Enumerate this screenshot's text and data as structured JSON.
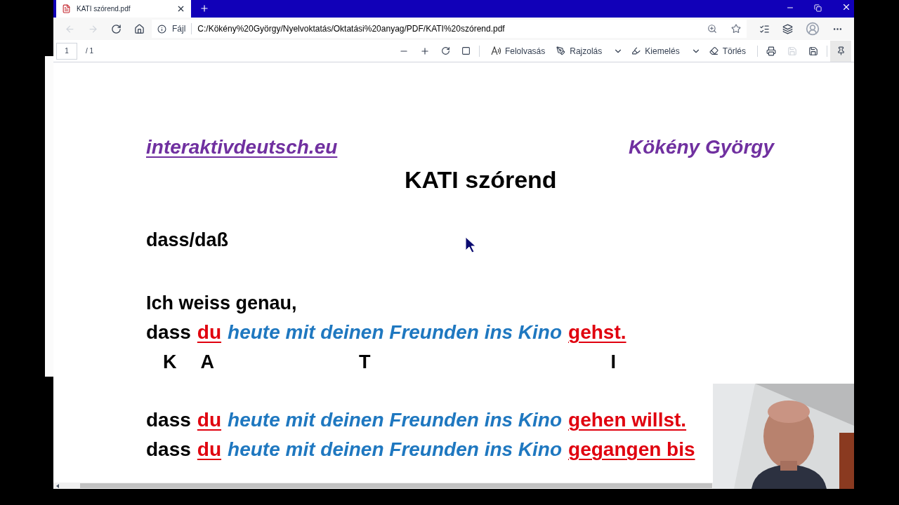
{
  "tab": {
    "title": "KATI szórend.pdf",
    "selected": true
  },
  "address_bar": {
    "scheme_label": "Fájl",
    "url": "C:/Kökény%20György/Nyelvoktatás/Oktatási%20anyag/PDF/KATI%20szórend.pdf"
  },
  "pdf_toolbar": {
    "page": "1",
    "page_count": "/ 1",
    "tools": [
      {
        "kind": "read",
        "label": "Felolvasás"
      },
      {
        "kind": "draw",
        "label": "Rajzolás"
      },
      {
        "kind": "highlight",
        "label": "Kiemelés"
      },
      {
        "kind": "erase",
        "label": "Törlés"
      }
    ]
  },
  "document": {
    "link": "interaktivdeutsch.eu",
    "author": "Kökény György",
    "title": "KATI szórend",
    "heading": "dass/daß",
    "intro": "Ich weiss genau,",
    "sentences": [
      {
        "parts": [
          {
            "kind": "plain",
            "text": "dass"
          },
          {
            "kind": "subject",
            "text": "du"
          },
          {
            "kind": "middle",
            "text": "heute mit deinen Freunden ins Kino"
          },
          {
            "kind": "verb",
            "text": "gehst."
          }
        ]
      },
      {
        "kind": "letters",
        "letters": [
          "K",
          "A",
          "T",
          "I"
        ]
      },
      {
        "parts": [
          {
            "kind": "plain",
            "text": "dass"
          },
          {
            "kind": "subject",
            "text": "du"
          },
          {
            "kind": "middle",
            "text": "heute mit deinen Freunden ins Kino"
          },
          {
            "kind": "verb",
            "text": "gehen willst."
          }
        ]
      },
      {
        "parts": [
          {
            "kind": "plain",
            "text": "dass"
          },
          {
            "kind": "subject",
            "text": "du"
          },
          {
            "kind": "middle",
            "text": "heute mit deinen Freunden ins Kino"
          },
          {
            "kind": "verb",
            "text": "gegangen bis"
          }
        ]
      }
    ]
  }
}
